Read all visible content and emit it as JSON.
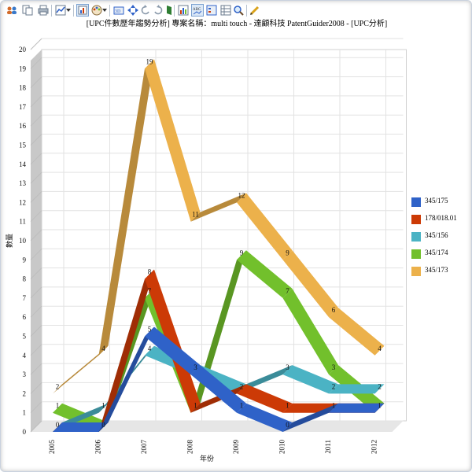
{
  "window": {
    "title": "[UPC件數歷年趨勢分析] 專案名稱：multi touch - 達顧科技 PatentGuider2008 - [UPC分析]"
  },
  "toolbar": {
    "icons": [
      "users-icon",
      "copy-icon",
      "print-icon",
      "chart-type-icon",
      "dropdown-arrow-icon",
      "chart-properties-icon",
      "palette-icon",
      "dropdown-arrow-icon",
      "3d-toggle-icon",
      "move-icon",
      "rotate-left-icon",
      "rotate-right-icon",
      "wall-icon",
      "data-grid-icon",
      "axis-label-icon",
      "legend-icon",
      "table-icon",
      "zoom-icon",
      "edit-icon"
    ]
  },
  "chart_data": {
    "type": "line",
    "style": "3d-ribbon",
    "title": "[UPC件數歷年趨勢分析] 專案名稱：multi touch - 達顧科技 PatentGuider2008 - [UPC分析]",
    "xlabel": "年份",
    "ylabel": "數量",
    "categories": [
      "2005",
      "2006",
      "2007",
      "2008",
      "2009",
      "2010",
      "2011",
      "2012"
    ],
    "ylim": [
      0,
      20
    ],
    "yticks": [
      "0",
      "1",
      "2",
      "3",
      "4",
      "5",
      "6",
      "7",
      "8",
      "9",
      "10",
      "11",
      "12",
      "13",
      "14",
      "15",
      "16",
      "17",
      "18",
      "19",
      "20"
    ],
    "grid": true,
    "legend_position": "right",
    "series": [
      {
        "name": "345/175",
        "color": "#2f62c8",
        "values": [
          0,
          0,
          5,
          3,
          1,
          0,
          1,
          1
        ],
        "labels": [
          "0",
          "",
          "5",
          "",
          "1",
          "0",
          "",
          ""
        ]
      },
      {
        "name": "178/018.01",
        "color": "#cc3a06",
        "values": [
          0,
          0,
          8,
          1,
          2,
          1,
          1,
          1
        ],
        "labels": [
          "",
          "",
          "8",
          "",
          "",
          "1",
          "1",
          ""
        ]
      },
      {
        "name": "345/156",
        "color": "#4bb3c4",
        "values": [
          0,
          1,
          4,
          3,
          2,
          3,
          2,
          2
        ],
        "labels": [
          "",
          "1",
          "4",
          "3",
          "2",
          "3",
          "2",
          "2"
        ]
      },
      {
        "name": "345/174",
        "color": "#72c02c",
        "values": [
          1,
          0,
          7,
          1,
          9,
          7,
          3,
          1
        ],
        "labels": [
          "1",
          "0",
          "7",
          "1",
          "9",
          "7",
          "3",
          "1"
        ]
      },
      {
        "name": "345/173",
        "color": "#ecb14b",
        "values": [
          2,
          4,
          19,
          11,
          12,
          9,
          6,
          4
        ],
        "labels": [
          "2",
          "4",
          "19",
          "11",
          "12",
          "9",
          "6",
          "4"
        ]
      }
    ]
  }
}
